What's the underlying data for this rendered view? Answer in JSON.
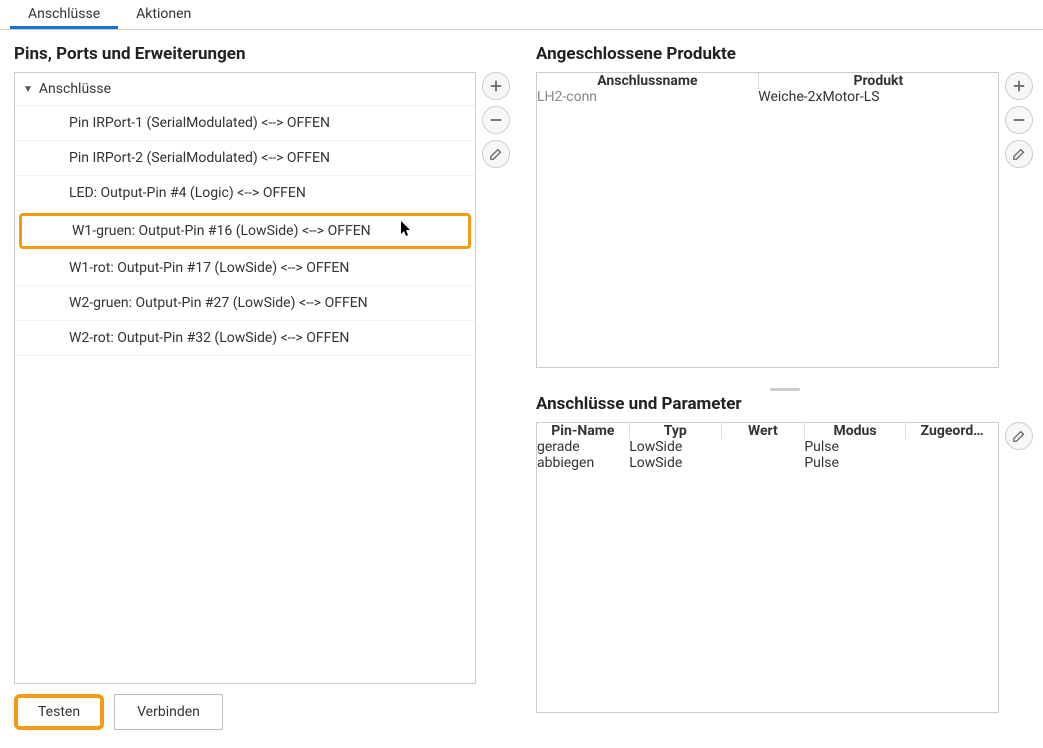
{
  "tabs": {
    "connections": "Anschlüsse",
    "actions": "Aktionen"
  },
  "left": {
    "title": "Pins, Ports und Erweiterungen",
    "root_label": "Anschlüsse",
    "items": [
      "Pin IRPort-1 (SerialModulated) <--> OFFEN",
      "Pin IRPort-2 (SerialModulated) <--> OFFEN",
      "LED: Output-Pin #4 (Logic) <--> OFFEN",
      "W1-gruen: Output-Pin #16 (LowSide) <--> OFFEN",
      "W1-rot: Output-Pin #17 (LowSide) <--> OFFEN",
      "W2-gruen: Output-Pin #27 (LowSide) <--> OFFEN",
      "W2-rot: Output-Pin #32 (LowSide) <--> OFFEN"
    ],
    "buttons": {
      "test": "Testen",
      "connect": "Verbinden"
    }
  },
  "products": {
    "title": "Angeschlossene Produkte",
    "headers": {
      "conn": "Anschlussname",
      "product": "Produkt"
    },
    "rows": [
      {
        "conn": "LH2-conn",
        "product": "Weiche-2xMotor-LS"
      }
    ]
  },
  "params": {
    "title": "Anschlüsse und Parameter",
    "headers": {
      "pin": "Pin-Name",
      "type": "Typ",
      "value": "Wert",
      "mode": "Modus",
      "assigned": "Zugeord…"
    },
    "rows": [
      {
        "pin": "gerade",
        "type": "LowSide",
        "value": "",
        "mode": "Pulse",
        "assigned": ""
      },
      {
        "pin": "abbiegen",
        "type": "LowSide",
        "value": "",
        "mode": "Pulse",
        "assigned": ""
      }
    ]
  }
}
